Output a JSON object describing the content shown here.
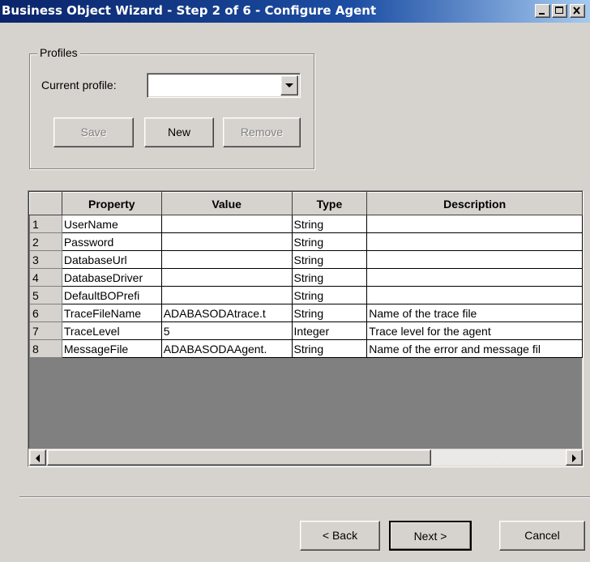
{
  "window": {
    "title": "Business Object Wizard - Step 2 of 6 - Configure Agent"
  },
  "profiles": {
    "group_label": "Profiles",
    "current_profile_label": "Current profile:",
    "current_profile_value": "",
    "save_label": "Save",
    "new_label": "New",
    "remove_label": "Remove"
  },
  "grid": {
    "columns": [
      "Property",
      "Value",
      "Type",
      "Description"
    ],
    "rows": [
      {
        "num": "1",
        "property": "UserName",
        "value": "",
        "type": "String",
        "description": ""
      },
      {
        "num": "2",
        "property": "Password",
        "value": "",
        "type": "String",
        "description": ""
      },
      {
        "num": "3",
        "property": "DatabaseUrl",
        "value": "",
        "type": "String",
        "description": ""
      },
      {
        "num": "4",
        "property": "DatabaseDriver",
        "value": "",
        "type": "String",
        "description": ""
      },
      {
        "num": "5",
        "property": "DefaultBOPrefi",
        "value": "",
        "type": "String",
        "description": ""
      },
      {
        "num": "6",
        "property": "TraceFileName",
        "value": "ADABASODAtrace.t",
        "type": "String",
        "description": "Name of the trace file"
      },
      {
        "num": "7",
        "property": "TraceLevel",
        "value": "5",
        "type": "Integer",
        "description": "Trace level for the agent"
      },
      {
        "num": "8",
        "property": "MessageFile",
        "value": "ADABASODAAgent.",
        "type": "String",
        "description": "Name of the error and message fil"
      }
    ]
  },
  "footer": {
    "back_label": "< Back",
    "next_label": "Next >",
    "cancel_label": "Cancel"
  },
  "icons": {
    "minimize": "minimize-icon",
    "maximize": "maximize-icon",
    "close": "close-icon",
    "dropdown": "chevron-down-icon",
    "scroll_left": "scroll-left-icon",
    "scroll_right": "scroll-right-icon"
  },
  "colors": {
    "titlebar_start": "#0a246a",
    "titlebar_end": "#a6caf0",
    "face": "#d6d3ce"
  }
}
